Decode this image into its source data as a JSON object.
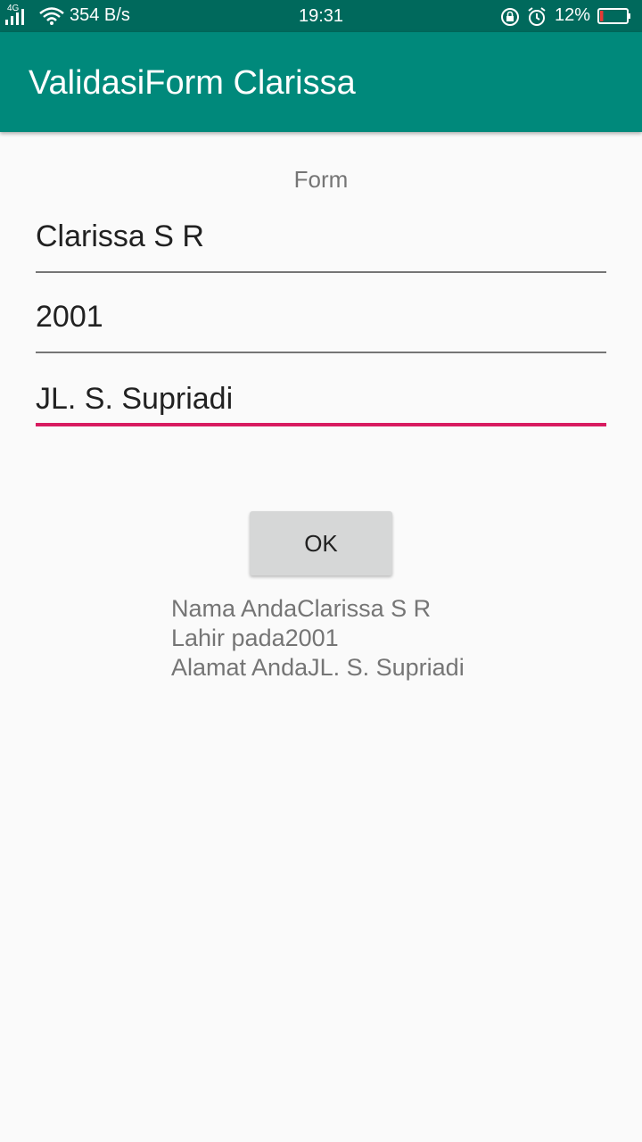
{
  "status_bar": {
    "network_type": "4G",
    "net_speed": "354 B/s",
    "time": "19:31",
    "battery_percent": "12%",
    "battery_level": 0.12,
    "icons": [
      "signal-icon",
      "wifi-icon",
      "rotation-lock-icon",
      "alarm-icon",
      "battery-icon"
    ]
  },
  "app_bar": {
    "title": "ValidasiForm Clarissa",
    "color": "#00897b"
  },
  "form": {
    "label": "Form",
    "name_value": "Clarissa S R",
    "year_value": "2001",
    "address_value": "JL. S. Supriadi",
    "focused_color": "#d81b60"
  },
  "ok_button": {
    "label": "OK"
  },
  "result": {
    "line1": "Nama AndaClarissa S R",
    "line2": "Lahir pada2001",
    "line3": "Alamat AndaJL. S. Supriadi"
  }
}
